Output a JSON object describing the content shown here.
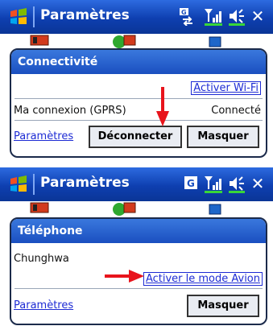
{
  "panel1": {
    "title": "Paramètres",
    "bubble_title": "Connectivité",
    "wifi_link": "Activer Wi-Fi",
    "connection_name": "Ma connexion (GPRS)",
    "connection_status": "Connecté",
    "settings_link": "Paramètres",
    "disconnect_button": "Déconnecter",
    "hide_button": "Masquer"
  },
  "panel2": {
    "title": "Paramètres",
    "bubble_title": "Téléphone",
    "operator": "Chunghwa",
    "airplane_link": "Activer le mode Avion",
    "settings_link": "Paramètres",
    "hide_button": "Masquer"
  },
  "colors": {
    "titlebar": "#1a4fc0",
    "link": "#1d2bd4",
    "arrow": "#e8141c"
  }
}
